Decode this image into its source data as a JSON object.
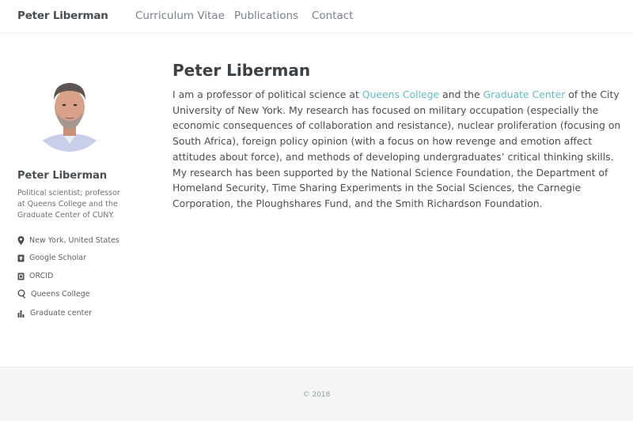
{
  "masthead": {
    "site_title": "Peter Liberman",
    "nav": [
      "Curriculum Vitae",
      "Publications",
      "Contact"
    ]
  },
  "sidebar": {
    "name": "Peter Liberman",
    "bio": "Political scientist; professor at Queens College and the Graduate Center of CUNY.",
    "links": [
      {
        "label": "New York, United States",
        "icon": "map-marker-icon"
      },
      {
        "label": "Google Scholar",
        "icon": "graduation-cap-icon"
      },
      {
        "label": "ORCID",
        "icon": "orcid-icon"
      },
      {
        "label": "Queens College",
        "icon": "college-icon"
      },
      {
        "label": "Graduate center",
        "icon": "bar-chart-icon"
      }
    ]
  },
  "main": {
    "title": "Peter Liberman",
    "paragraph": {
      "part1": "I am a professor of political science at ",
      "link1": "Queens College",
      "part2": " and the ",
      "link2": "Graduate Center",
      "part3": " of the City University of New York. My research has focused on military occupation (especially the economic consequences of collaboration and resistance), nuclear proliferation (focusing on South Africa), foreign policy opinion (with a focus on how revenge and emotion affect attitudes about force), and methods of developing undergraduates’ critical thinking skills. My research has been supported by the National Science Foundation, the Department of Homeland Security, Time Sharing Experiments in the Social Sciences, the Carnegie Corporation, the Ploughshares Fund, and the Smith Richardson Foundation."
    }
  },
  "footer": {
    "copyright": "© 2018"
  },
  "colors": {
    "link": "#5fbdc4",
    "text": "#494e52",
    "footer_bg": "#f4f6f6"
  }
}
